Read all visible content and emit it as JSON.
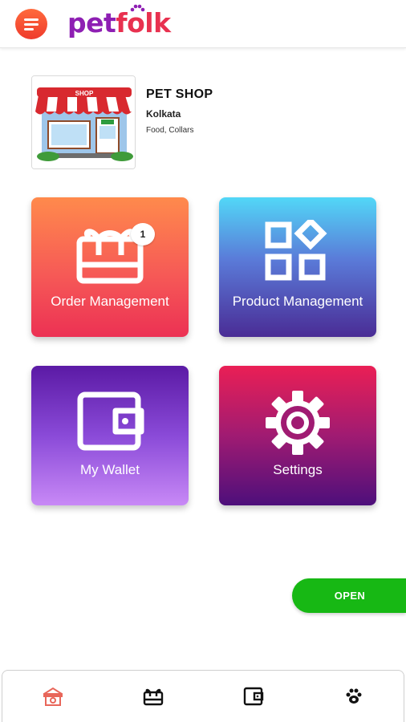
{
  "header": {
    "logo_part1": "pet",
    "logo_part2": "folk",
    "colors": {
      "pet": "#8e1fb3",
      "folk": "#e8314f",
      "menu": "#ef3b2c"
    }
  },
  "shop": {
    "name": "PET SHOP",
    "city": "Kolkata",
    "categories": "Food, Collars",
    "thumbnail_icon": "shop-storefront-icon"
  },
  "tiles": {
    "order": {
      "label": "Order Management",
      "icon": "gift-card-icon",
      "badge": "1"
    },
    "product": {
      "label": "Product Management",
      "icon": "apps-grid-icon"
    },
    "wallet": {
      "label": "My Wallet",
      "icon": "wallet-icon"
    },
    "settings": {
      "label": "Settings",
      "icon": "gear-icon"
    }
  },
  "open_button": {
    "label": "OPEN",
    "color": "#17b814"
  },
  "bottom_nav": [
    {
      "icon": "shop-icon",
      "active": true
    },
    {
      "icon": "gift-card-icon",
      "active": false
    },
    {
      "icon": "wallet-icon",
      "active": false
    },
    {
      "icon": "paw-icon",
      "active": false
    }
  ]
}
